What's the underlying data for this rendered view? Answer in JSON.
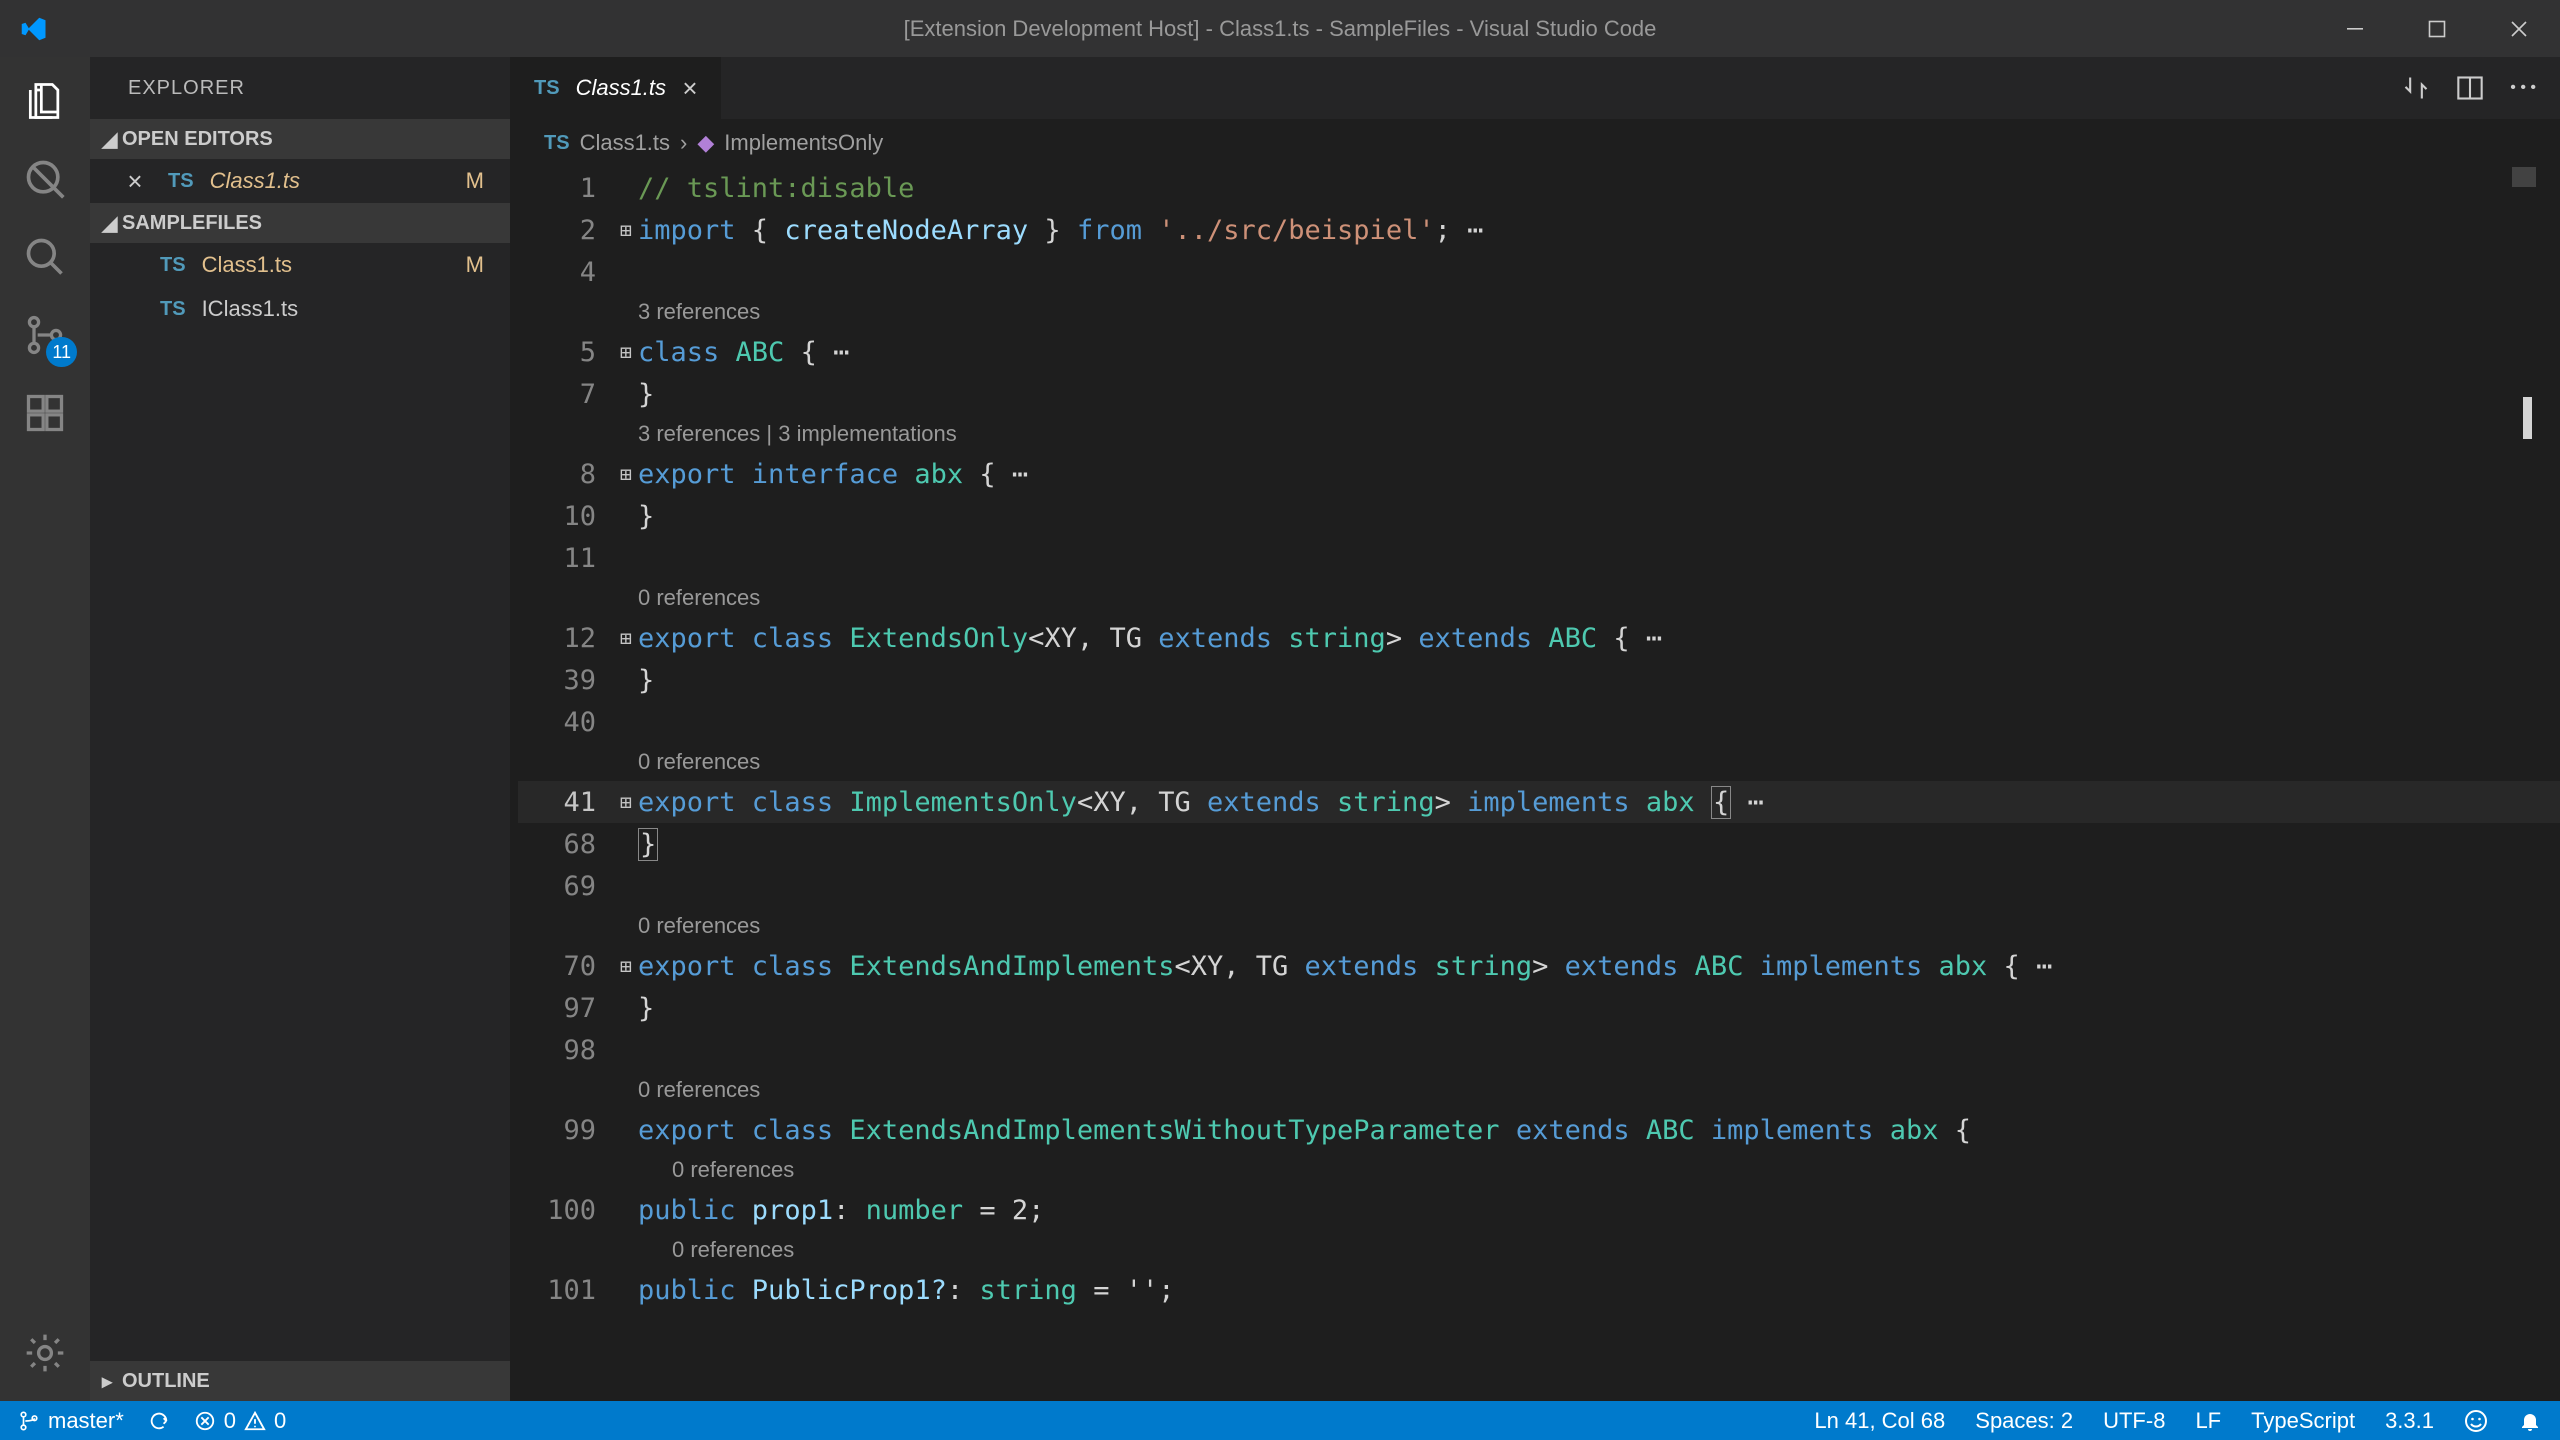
{
  "titlebar": {
    "title": "[Extension Development Host] - Class1.ts - SampleFiles - Visual Studio Code"
  },
  "activitybar": {
    "scm_badge": "11"
  },
  "sidebar": {
    "title": "EXPLORER",
    "open_editors_label": "OPEN EDITORS",
    "samplefiles_label": "SAMPLEFILES",
    "outline_label": "OUTLINE",
    "open_editor": {
      "lang": "TS",
      "name": "Class1.ts",
      "m": "M"
    },
    "files": [
      {
        "lang": "TS",
        "name": "Class1.ts",
        "m": "M"
      },
      {
        "lang": "TS",
        "name": "IClass1.ts",
        "m": ""
      }
    ]
  },
  "tab": {
    "lang": "TS",
    "name": "Class1.ts"
  },
  "breadcrumb": {
    "file_lang": "TS",
    "file": "Class1.ts",
    "symbol": "ImplementsOnly"
  },
  "code": {
    "l1_comment": "// tslint:disable",
    "l2_import": "import",
    "l2_braceopen": " { ",
    "l2_ident": "createNodeArray",
    "l2_braceclose": " } ",
    "l2_from": "from",
    "l2_str": " '../src/beispiel'",
    "l2_semi": "; ",
    "lens_3ref": "3 references",
    "l5_class": "class",
    "l5_name": " ABC ",
    "l5_brace": "{ ",
    "l7_brace": "  }",
    "lens_3ref_3impl": "3 references | 3 implementations",
    "l8_export": "export",
    "l8_interface": " interface",
    "l8_name": " abx ",
    "l8_brace": "{ ",
    "l10_brace": "  }",
    "lens_0ref": "0 references",
    "l12_export": "export",
    "l12_class": " class",
    "l12_name": " ExtendsOnly",
    "l12_gen1": "<XY, TG ",
    "l12_extends1": "extends",
    "l12_string": " string",
    "l12_gt": "> ",
    "l12_extends2": "extends",
    "l12_abc": " ABC ",
    "l12_brace": "{ ",
    "l39_brace": "  }",
    "l41_export": "export",
    "l41_class": " class",
    "l41_name": " ImplementsOnly",
    "l41_gen1": "<XY, TG ",
    "l41_extends1": "extends",
    "l41_string": " string",
    "l41_gt": "> ",
    "l41_implements": "implements",
    "l41_abx": " abx ",
    "l41_brace_open": "{",
    "l68_brace": "  }",
    "l70_export": "export",
    "l70_class": " class",
    "l70_name": " ExtendsAndImplements",
    "l70_gen1": "<XY, TG ",
    "l70_extends1": "extends",
    "l70_string": " string",
    "l70_gt": "> ",
    "l70_extends2": "extends",
    "l70_abc": " ABC ",
    "l70_implements": "implements",
    "l70_abx": " abx ",
    "l70_brace": "{ ",
    "l97_brace": "  }",
    "l99_export": "export",
    "l99_class": " class",
    "l99_name": " ExtendsAndImplementsWithoutTypeParameter ",
    "l99_extends": "extends",
    "l99_abc": " ABC ",
    "l99_implements": "implements",
    "l99_abx": " abx ",
    "l99_brace": "{",
    "l100_public": "public",
    "l100_prop": " prop1",
    "l100_colon": ": ",
    "l100_type": "number",
    "l100_rest": " = 2;",
    "l101_public": "public",
    "l101_prop": " PublicProp1?",
    "l101_colon": ": ",
    "l101_type": "string",
    "l101_rest": " = '';",
    "ln": {
      "n1": "1",
      "n2": "2",
      "n4": "4",
      "n5": "5",
      "n7": "7",
      "n8": "8",
      "n10": "10",
      "n11": "11",
      "n12": "12",
      "n39": "39",
      "n40": "40",
      "n41": "41",
      "n68": "68",
      "n69": "69",
      "n70": "70",
      "n97": "97",
      "n98": "98",
      "n99": "99",
      "n100": "100",
      "n101": "101"
    }
  },
  "statusbar": {
    "branch": "master*",
    "errors": "0",
    "warnings": "0",
    "lncol": "Ln 41, Col 68",
    "spaces": "Spaces: 2",
    "encoding": "UTF-8",
    "eol": "LF",
    "lang": "TypeScript",
    "ver": "3.3.1"
  }
}
